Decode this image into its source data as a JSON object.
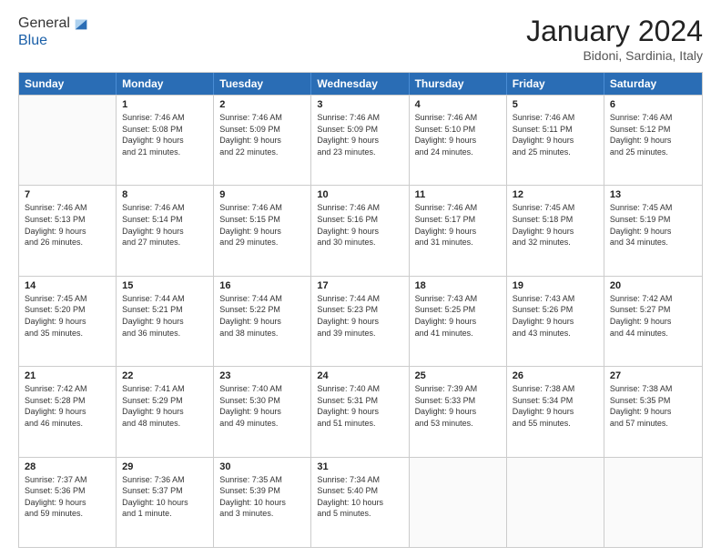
{
  "logo": {
    "line1": "General",
    "line2": "Blue"
  },
  "title": "January 2024",
  "subtitle": "Bidoni, Sardinia, Italy",
  "header_days": [
    "Sunday",
    "Monday",
    "Tuesday",
    "Wednesday",
    "Thursday",
    "Friday",
    "Saturday"
  ],
  "weeks": [
    [
      {
        "day": "",
        "lines": []
      },
      {
        "day": "1",
        "lines": [
          "Sunrise: 7:46 AM",
          "Sunset: 5:08 PM",
          "Daylight: 9 hours",
          "and 21 minutes."
        ]
      },
      {
        "day": "2",
        "lines": [
          "Sunrise: 7:46 AM",
          "Sunset: 5:09 PM",
          "Daylight: 9 hours",
          "and 22 minutes."
        ]
      },
      {
        "day": "3",
        "lines": [
          "Sunrise: 7:46 AM",
          "Sunset: 5:09 PM",
          "Daylight: 9 hours",
          "and 23 minutes."
        ]
      },
      {
        "day": "4",
        "lines": [
          "Sunrise: 7:46 AM",
          "Sunset: 5:10 PM",
          "Daylight: 9 hours",
          "and 24 minutes."
        ]
      },
      {
        "day": "5",
        "lines": [
          "Sunrise: 7:46 AM",
          "Sunset: 5:11 PM",
          "Daylight: 9 hours",
          "and 25 minutes."
        ]
      },
      {
        "day": "6",
        "lines": [
          "Sunrise: 7:46 AM",
          "Sunset: 5:12 PM",
          "Daylight: 9 hours",
          "and 25 minutes."
        ]
      }
    ],
    [
      {
        "day": "7",
        "lines": [
          "Sunrise: 7:46 AM",
          "Sunset: 5:13 PM",
          "Daylight: 9 hours",
          "and 26 minutes."
        ]
      },
      {
        "day": "8",
        "lines": [
          "Sunrise: 7:46 AM",
          "Sunset: 5:14 PM",
          "Daylight: 9 hours",
          "and 27 minutes."
        ]
      },
      {
        "day": "9",
        "lines": [
          "Sunrise: 7:46 AM",
          "Sunset: 5:15 PM",
          "Daylight: 9 hours",
          "and 29 minutes."
        ]
      },
      {
        "day": "10",
        "lines": [
          "Sunrise: 7:46 AM",
          "Sunset: 5:16 PM",
          "Daylight: 9 hours",
          "and 30 minutes."
        ]
      },
      {
        "day": "11",
        "lines": [
          "Sunrise: 7:46 AM",
          "Sunset: 5:17 PM",
          "Daylight: 9 hours",
          "and 31 minutes."
        ]
      },
      {
        "day": "12",
        "lines": [
          "Sunrise: 7:45 AM",
          "Sunset: 5:18 PM",
          "Daylight: 9 hours",
          "and 32 minutes."
        ]
      },
      {
        "day": "13",
        "lines": [
          "Sunrise: 7:45 AM",
          "Sunset: 5:19 PM",
          "Daylight: 9 hours",
          "and 34 minutes."
        ]
      }
    ],
    [
      {
        "day": "14",
        "lines": [
          "Sunrise: 7:45 AM",
          "Sunset: 5:20 PM",
          "Daylight: 9 hours",
          "and 35 minutes."
        ]
      },
      {
        "day": "15",
        "lines": [
          "Sunrise: 7:44 AM",
          "Sunset: 5:21 PM",
          "Daylight: 9 hours",
          "and 36 minutes."
        ]
      },
      {
        "day": "16",
        "lines": [
          "Sunrise: 7:44 AM",
          "Sunset: 5:22 PM",
          "Daylight: 9 hours",
          "and 38 minutes."
        ]
      },
      {
        "day": "17",
        "lines": [
          "Sunrise: 7:44 AM",
          "Sunset: 5:23 PM",
          "Daylight: 9 hours",
          "and 39 minutes."
        ]
      },
      {
        "day": "18",
        "lines": [
          "Sunrise: 7:43 AM",
          "Sunset: 5:25 PM",
          "Daylight: 9 hours",
          "and 41 minutes."
        ]
      },
      {
        "day": "19",
        "lines": [
          "Sunrise: 7:43 AM",
          "Sunset: 5:26 PM",
          "Daylight: 9 hours",
          "and 43 minutes."
        ]
      },
      {
        "day": "20",
        "lines": [
          "Sunrise: 7:42 AM",
          "Sunset: 5:27 PM",
          "Daylight: 9 hours",
          "and 44 minutes."
        ]
      }
    ],
    [
      {
        "day": "21",
        "lines": [
          "Sunrise: 7:42 AM",
          "Sunset: 5:28 PM",
          "Daylight: 9 hours",
          "and 46 minutes."
        ]
      },
      {
        "day": "22",
        "lines": [
          "Sunrise: 7:41 AM",
          "Sunset: 5:29 PM",
          "Daylight: 9 hours",
          "and 48 minutes."
        ]
      },
      {
        "day": "23",
        "lines": [
          "Sunrise: 7:40 AM",
          "Sunset: 5:30 PM",
          "Daylight: 9 hours",
          "and 49 minutes."
        ]
      },
      {
        "day": "24",
        "lines": [
          "Sunrise: 7:40 AM",
          "Sunset: 5:31 PM",
          "Daylight: 9 hours",
          "and 51 minutes."
        ]
      },
      {
        "day": "25",
        "lines": [
          "Sunrise: 7:39 AM",
          "Sunset: 5:33 PM",
          "Daylight: 9 hours",
          "and 53 minutes."
        ]
      },
      {
        "day": "26",
        "lines": [
          "Sunrise: 7:38 AM",
          "Sunset: 5:34 PM",
          "Daylight: 9 hours",
          "and 55 minutes."
        ]
      },
      {
        "day": "27",
        "lines": [
          "Sunrise: 7:38 AM",
          "Sunset: 5:35 PM",
          "Daylight: 9 hours",
          "and 57 minutes."
        ]
      }
    ],
    [
      {
        "day": "28",
        "lines": [
          "Sunrise: 7:37 AM",
          "Sunset: 5:36 PM",
          "Daylight: 9 hours",
          "and 59 minutes."
        ]
      },
      {
        "day": "29",
        "lines": [
          "Sunrise: 7:36 AM",
          "Sunset: 5:37 PM",
          "Daylight: 10 hours",
          "and 1 minute."
        ]
      },
      {
        "day": "30",
        "lines": [
          "Sunrise: 7:35 AM",
          "Sunset: 5:39 PM",
          "Daylight: 10 hours",
          "and 3 minutes."
        ]
      },
      {
        "day": "31",
        "lines": [
          "Sunrise: 7:34 AM",
          "Sunset: 5:40 PM",
          "Daylight: 10 hours",
          "and 5 minutes."
        ]
      },
      {
        "day": "",
        "lines": []
      },
      {
        "day": "",
        "lines": []
      },
      {
        "day": "",
        "lines": []
      }
    ]
  ]
}
